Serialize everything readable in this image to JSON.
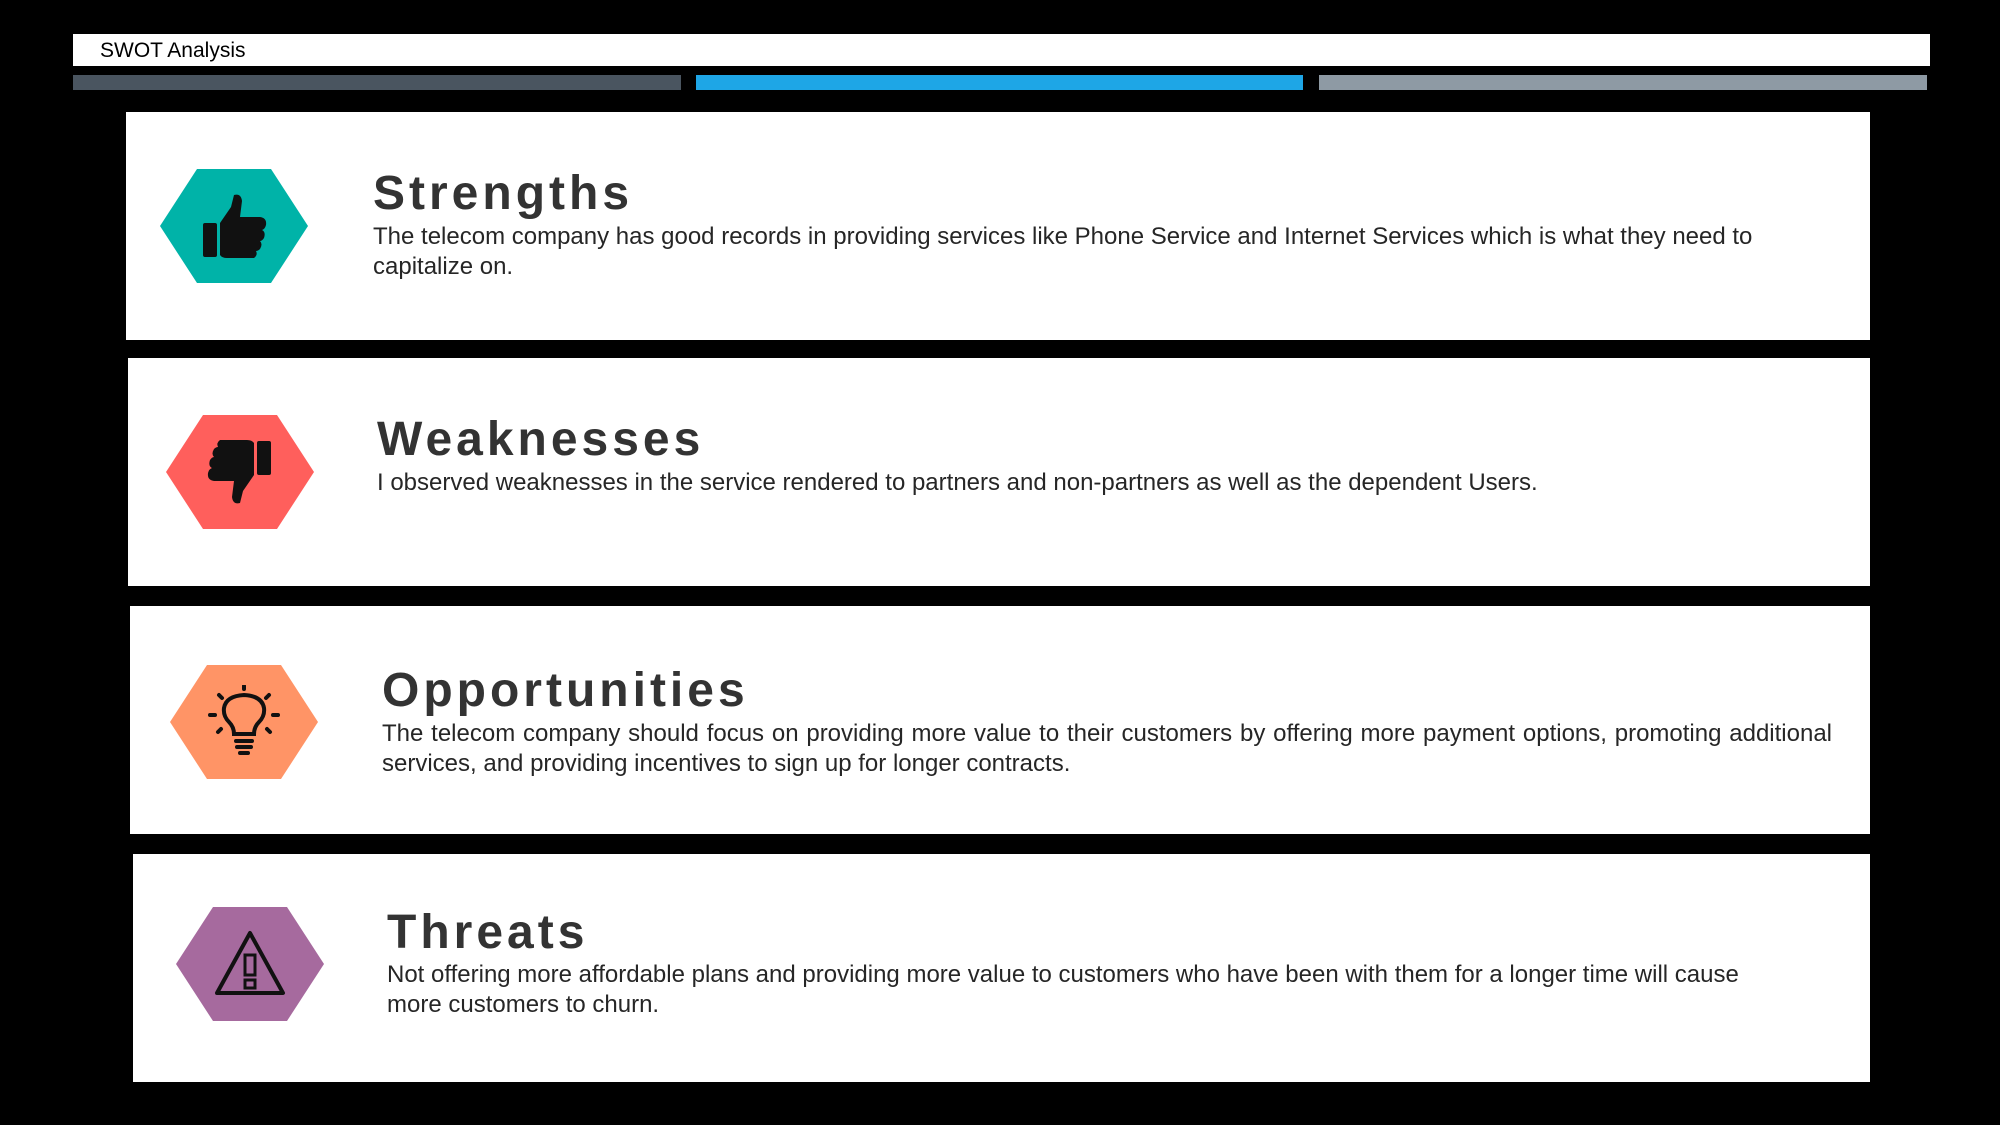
{
  "header": {
    "title": "SWOT Analysis"
  },
  "accent_colors": [
    "#4a5560",
    "#1ea6e6",
    "#8e9aa4"
  ],
  "sections": [
    {
      "title": "Strengths",
      "text": "The telecom company has good records in providing services like Phone Service and Internet Services which is what they need to capitalize on.",
      "icon": "thumbs-up-icon",
      "color": "#00b3a8"
    },
    {
      "title": "Weaknesses",
      "text": "I observed weaknesses in the service rendered to partners and non-partners as well as the dependent Users.",
      "icon": "thumbs-down-icon",
      "color": "#ff5f5c"
    },
    {
      "title": "Opportunities",
      "text": "The telecom company should focus on providing more value to their customers by offering more payment options, promoting additional services, and providing incentives to sign up for longer contracts.",
      "icon": "lightbulb-icon",
      "color": "#ff9466"
    },
    {
      "title": "Threats",
      "text": "Not offering more affordable plans and providing more value to customers who have been with them for a longer time will cause more customers to churn.",
      "icon": "warning-icon",
      "color": "#a66a9e"
    }
  ]
}
